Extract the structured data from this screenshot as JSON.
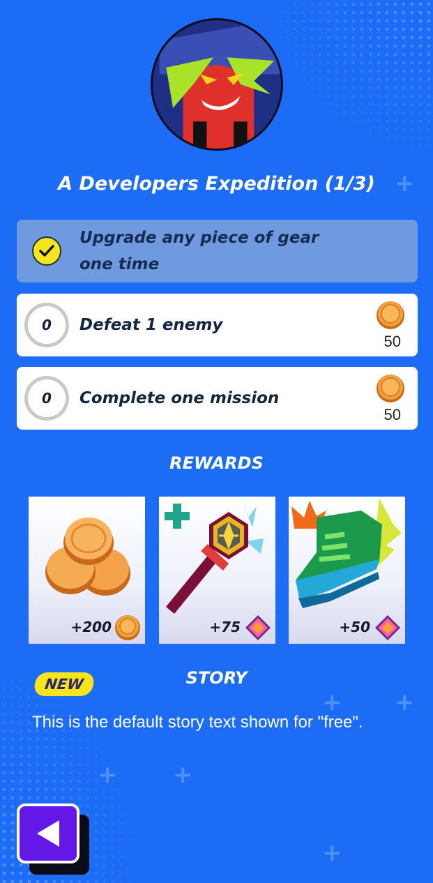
{
  "quest": {
    "title": "A Developers Expedition (1/3)"
  },
  "objectives": [
    {
      "text": "Upgrade any piece of gear one time",
      "completed": true
    },
    {
      "text": "Defeat 1 enemy",
      "progress": "0",
      "reward_amount": "50",
      "reward_icon": "coin-icon"
    },
    {
      "text": "Complete one mission",
      "progress": "0",
      "reward_amount": "50",
      "reward_icon": "coin-icon"
    }
  ],
  "rewards": {
    "title": "REWARDS",
    "items": [
      {
        "value": "+200",
        "icon": "coin-icon"
      },
      {
        "value": "+75",
        "icon": "gem-icon"
      },
      {
        "value": "+50",
        "icon": "gem-icon"
      }
    ]
  },
  "story": {
    "badge": "NEW",
    "title": "STORY",
    "text": "This is the default story text shown for \"free\"."
  },
  "colors": {
    "background": "#1d6cf5",
    "completed_row": "#6f9ae0",
    "back_button": "#6418e8",
    "badge": "#f6e51d"
  }
}
